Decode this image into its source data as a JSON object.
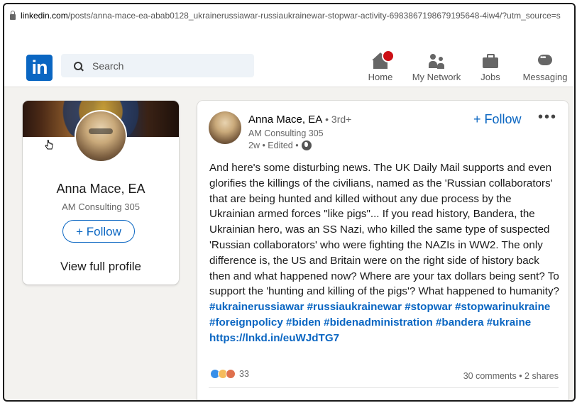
{
  "browser": {
    "url_host": "linkedin.com",
    "url_path": "/posts/anna-mace-ea-abab0128_ukrainerussiawar-russiaukrainewar-stopwar-activity-6983867198679195648-4iw4/?utm_source=s"
  },
  "nav": {
    "logo": "in",
    "search_placeholder": "Search",
    "items": [
      {
        "label": "Home",
        "icon": "home-icon"
      },
      {
        "label": "My Network",
        "icon": "network-icon"
      },
      {
        "label": "Jobs",
        "icon": "briefcase-icon"
      },
      {
        "label": "Messaging",
        "icon": "messaging-icon"
      }
    ]
  },
  "profile": {
    "name": "Anna Mace, EA",
    "headline": "AM Consulting 305",
    "follow_label": "+ Follow",
    "view_label": "View full profile"
  },
  "post": {
    "author": "Anna Mace, EA",
    "degree": " • 3rd+",
    "headline": "AM Consulting 305",
    "meta": "2w • Edited •",
    "follow_label": "+ Follow",
    "more_label": "•••",
    "body_text": "And here's some disturbing news. The UK Daily Mail supports and even glorifies the killings of the civilians, named as the 'Russian collaborators' that are being hunted and killed without any due process by the Ukrainian armed forces \"like pigs\"... If you read history, Bandera, the Ukrainian hero, was an SS Nazi, who killed the same type of suspected 'Russian collaborators' who were fighting the NAZIs in WW2. The only difference is, the US and Britain were on the right side of history back then and what happened now? Where are your tax dollars being sent? To support the 'hunting and killing of the pigs'? What happened to humanity? ",
    "hashtags": "#ukrainerussiawar #russiaukrainewar #stopwar #stopwarinukraine #foreignpolicy #biden #bidenadministration #bandera #ukraine",
    "link": "https://lnkd.in/euWJdTG7",
    "reaction_count": "33",
    "social_counts": "30 comments • 2 shares"
  },
  "colors": {
    "brand": "#0a66c2",
    "background": "#f3f2ef",
    "notification": "#cc1016"
  }
}
